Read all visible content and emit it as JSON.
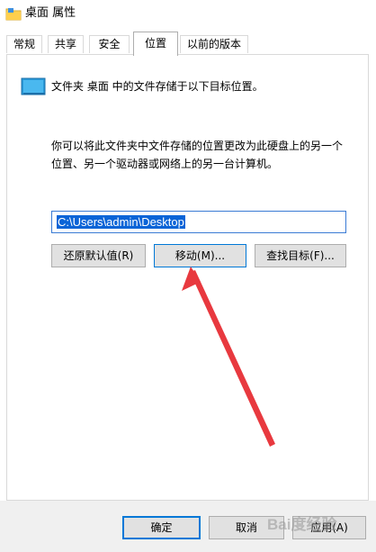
{
  "window": {
    "title": "桌面 属性",
    "icon": "folder-icon"
  },
  "tabs": [
    {
      "label": "常规",
      "active": false
    },
    {
      "label": "共享",
      "active": false
    },
    {
      "label": "安全",
      "active": false
    },
    {
      "label": "位置",
      "active": true
    },
    {
      "label": "以前的版本",
      "active": false
    }
  ],
  "location": {
    "icon": "desktop-folder-icon",
    "description": "文件夹 桌面 中的文件存储于以下目标位置。",
    "info_line1": "你可以将此文件夹中文件存储的位置更改为此硬盘上的另一个",
    "info_line2": "位置、另一个驱动器或网络上的另一台计算机。",
    "path_value": "C:\\Users\\admin\\Desktop",
    "buttons": {
      "restore": "还原默认值(R)",
      "move": "移动(M)...",
      "find_target": "查找目标(F)..."
    }
  },
  "footer": {
    "ok": "确定",
    "cancel": "取消",
    "apply": "应用(A)"
  },
  "watermark": {
    "text": "Bai度经验"
  },
  "colors": {
    "annotation_arrow": "#e8393f",
    "selection": "#0a64d7",
    "focus_border": "#0078d7"
  }
}
